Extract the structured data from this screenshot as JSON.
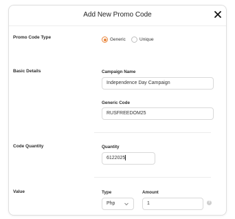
{
  "modal": {
    "title": "Add New Promo Code",
    "close_icon": "close-icon"
  },
  "promo_code_type": {
    "label": "Promo Code Type",
    "options": [
      {
        "label": "Generic",
        "selected": true
      },
      {
        "label": "Unique",
        "selected": false
      }
    ]
  },
  "basic_details": {
    "label": "Basic Details",
    "campaign_name": {
      "label": "Campaign Name",
      "value": "Independence Day Campaign"
    },
    "generic_code": {
      "label": "Generic Code",
      "value": "RUSFREEDOM25"
    }
  },
  "code_quantity": {
    "label": "Code Quantity",
    "quantity": {
      "label": "Quantity",
      "value": "6122025"
    }
  },
  "value": {
    "label": "Value",
    "type": {
      "label": "Type",
      "selected": "Php"
    },
    "amount": {
      "label": "Amount",
      "value": "1"
    },
    "help_icon": "help-icon"
  },
  "colors": {
    "accent": "#e9853a",
    "border": "#d9d9d9"
  }
}
